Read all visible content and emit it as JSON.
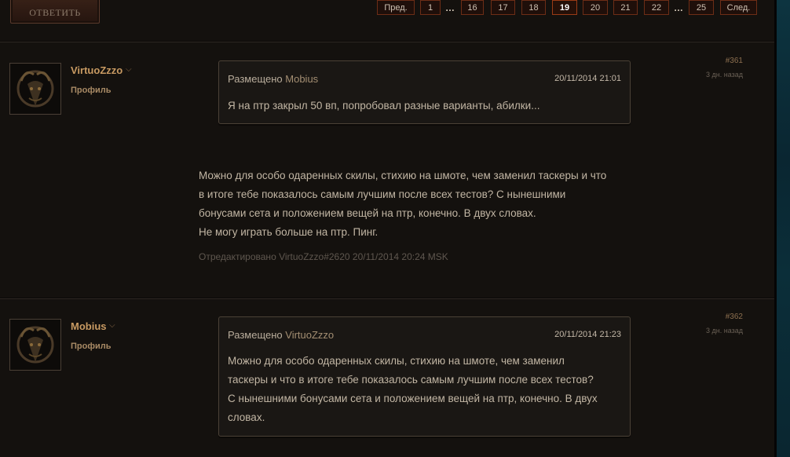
{
  "toolbar": {
    "reply_label": "ОТВЕТИТЬ"
  },
  "pagination": {
    "prev": "Пред.",
    "next": "След.",
    "ellipsis": "…",
    "pages": [
      "1",
      "16",
      "17",
      "18",
      "19",
      "20",
      "21",
      "22",
      "25"
    ],
    "current": "19"
  },
  "posts": [
    {
      "author": "VirtuoZzzo",
      "profile_label": "Профиль",
      "number": "#361",
      "time_ago": "3 дн. назад",
      "quote": {
        "prefix": "Размещено",
        "author": "Mobius",
        "date": "20/11/2014 21:01",
        "text": "Я на птр закрыл 50 вп, попробовал разные варианты, абилки..."
      },
      "body_lines": [
        "Можно для особо одаренных скилы, стихию на шмоте, чем заменил таскеры и что",
        "в итоге тебе показалось самым лучшим после всех тестов? С нынешними",
        "бонусами сета и положением вещей на птр, конечно. В двух словах.",
        "Не могу играть больше на птр. Пинг."
      ],
      "edited": "Отредактировано VirtuoZzzo#2620 20/11/2014 20:24 MSK"
    },
    {
      "author": "Mobius",
      "profile_label": "Профиль",
      "number": "#362",
      "time_ago": "3 дн. назад",
      "quote": {
        "prefix": "Размещено",
        "author": "VirtuoZzzo",
        "date": "20/11/2014 21:23",
        "lines": [
          "Можно для особо одаренных скилы, стихию на шмоте, чем заменил",
          "таскеры и что в итоге тебе показалось самым лучшим после всех тестов?",
          "С нынешними бонусами сета и положением вещей на птр, конечно. В двух",
          "словах."
        ]
      }
    }
  ],
  "colors": {
    "background": "#14110e",
    "username": "#c89a62",
    "pager_border": "#6d2d16",
    "scrollbar_teal": "#0b2e39"
  }
}
